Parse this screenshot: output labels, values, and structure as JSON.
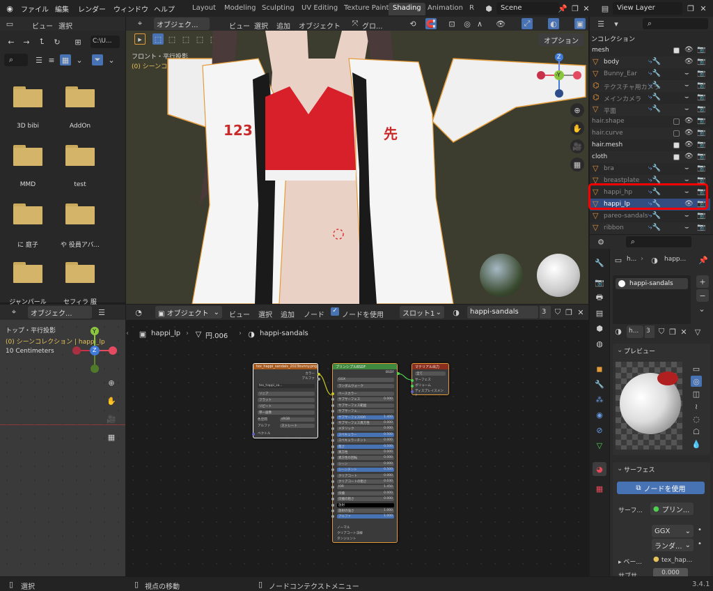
{
  "topbar": {
    "menus": [
      "ファイル",
      "編集",
      "レンダー",
      "ウィンドウ",
      "ヘルプ"
    ],
    "workspaces": [
      "Layout",
      "Modeling",
      "Sculpting",
      "UV Editing",
      "Texture Paint",
      "Shading",
      "Animation",
      "R"
    ],
    "active_workspace": "Shading",
    "scene": "Scene",
    "view_layer": "View Layer"
  },
  "filebrowser": {
    "menus": [
      "ビュー",
      "選択"
    ],
    "path": "C:\\U...",
    "folders": [
      "3D bibi",
      "AddOn",
      "MMD",
      "test",
      "に 庭子",
      "や 役員アバ...",
      "ジャンパール",
      "セフィラ 服"
    ]
  },
  "viewport": {
    "mode": "オブジェク...",
    "menus": [
      "ビュー",
      "選択",
      "追加",
      "オブジェクト"
    ],
    "transform": "グロ...",
    "options": "オプション",
    "view_name": "フロント・平行投影",
    "collection": "(0) シーンコレクション | happi_lp",
    "gizmo": {
      "z": "Z",
      "y": "-Y"
    }
  },
  "outliner": {
    "header": "ンコレクション",
    "rows": [
      {
        "label": "mesh",
        "type": "collection"
      },
      {
        "label": "body",
        "type": "object"
      },
      {
        "label": "Bunny_Ear",
        "type": "object"
      },
      {
        "label": "テクスチャ用カメラ",
        "type": "camera"
      },
      {
        "label": "メインカメラ",
        "type": "camera"
      },
      {
        "label": "平面",
        "type": "object"
      },
      {
        "label": "hair.shape",
        "type": "collection"
      },
      {
        "label": "hair.curve",
        "type": "collection"
      },
      {
        "label": "hair.mesh",
        "type": "collection"
      },
      {
        "label": "cloth",
        "type": "collection"
      },
      {
        "label": "bra",
        "type": "object"
      },
      {
        "label": "breastplate",
        "type": "object"
      },
      {
        "label": "happi_hp",
        "type": "object"
      },
      {
        "label": "happi_lp",
        "type": "object"
      },
      {
        "label": "pareo-sandals",
        "type": "object"
      },
      {
        "label": "ribbon",
        "type": "object"
      }
    ]
  },
  "properties": {
    "object_short": "h...",
    "material_short": "happ...",
    "material_slot": "happi-sandals",
    "mat_name_short": "h...",
    "users": "3",
    "preview_label": "プレビュー",
    "surface_label": "サーフェス",
    "use_nodes": "ノードを使用",
    "surface_field_label": "サーフ...",
    "surface_shader": "プリン...",
    "distribution": "GGX",
    "subsurface_method": "ランダ...",
    "base_label": "ベー...",
    "base_value": "tex_hap...",
    "subsurf_label": "サブサ...",
    "subsurf_value": "0.000",
    "version": "3.4.1"
  },
  "left_viewport": {
    "mode": "オブジェク...",
    "view_name": "トップ・平行投影",
    "collection": "(0) シーンコレクション | happi_lp",
    "scale": "10 Centimeters",
    "gizmo": {
      "y": "Y",
      "z": "Z"
    }
  },
  "node_editor": {
    "mode": "オブジェクト",
    "menus": [
      "ビュー",
      "選択",
      "追加",
      "ノード"
    ],
    "use_nodes": "ノードを使用",
    "slot": "スロット1",
    "material": "happi-sandals",
    "users": "3",
    "breadcrumb": [
      "happi_lp",
      "円.006",
      "happi-sandals"
    ],
    "image_node": {
      "title": "tex_happi_sandals_2023bunny.png",
      "outputs": [
        "カラー",
        "アルファ"
      ],
      "image": "tex_happi_sa...",
      "options": [
        "リニア",
        "フラット",
        "リピート",
        "単一画像"
      ],
      "color_space_label": "色空間",
      "color_space": "sRGB",
      "alpha_label": "アルファ",
      "alpha": "ストレート",
      "vector": "ベクトル"
    },
    "bsdf_node": {
      "title": "プリンシプルBSDF",
      "output": "BSDF",
      "dist": "GGX",
      "sss_method": "ランダムウォーク",
      "fields": [
        {
          "label": "ベースカラー",
          "value": "",
          "blue": false
        },
        {
          "label": "サブサーフェス",
          "value": "0.000",
          "blue": false
        },
        {
          "label": "サブサーフェス範囲",
          "value": "",
          "blue": false
        },
        {
          "label": "サブサーフェ...",
          "value": "",
          "blue": false
        },
        {
          "label": "サブサーフェスIOR",
          "value": "1.400",
          "blue": true
        },
        {
          "label": "サブサーフェス異方性",
          "value": "0.000",
          "blue": false
        },
        {
          "label": "メタリック",
          "value": "0.000",
          "blue": false
        },
        {
          "label": "スペキュラー",
          "value": "0.500",
          "blue": true
        },
        {
          "label": "スペキュラーチント",
          "value": "0.000",
          "blue": false
        },
        {
          "label": "粗さ",
          "value": "0.500",
          "blue": true
        },
        {
          "label": "異方性",
          "value": "0.000",
          "blue": false
        },
        {
          "label": "異方性の回転",
          "value": "0.000",
          "blue": false
        },
        {
          "label": "シーン",
          "value": "0.000",
          "blue": false
        },
        {
          "label": "シーンチント",
          "value": "0.500",
          "blue": true
        },
        {
          "label": "クリアコート",
          "value": "0.000",
          "blue": false
        },
        {
          "label": "クリアコートの粗さ",
          "value": "0.030",
          "blue": false
        },
        {
          "label": "IOR",
          "value": "1.450",
          "blue": false
        },
        {
          "label": "伝播",
          "value": "0.000",
          "blue": false
        },
        {
          "label": "伝播の粗さ",
          "value": "0.000",
          "blue": false
        },
        {
          "label": "放射",
          "value": "",
          "blue": false
        },
        {
          "label": "放射の強さ",
          "value": "1.000",
          "blue": false
        },
        {
          "label": "アルファ",
          "value": "1.000",
          "blue": true
        }
      ],
      "inputs_bottom": [
        "ノーマル",
        "クリアコート法線",
        "タンジェント"
      ]
    },
    "output_node": {
      "title": "マテリアル出力",
      "target": "全て",
      "inputs": [
        "サーフェス",
        "ボリューム",
        "ディスプレイスメント"
      ]
    }
  },
  "statusbar": {
    "select": "選択",
    "view_move": "視点の移動",
    "node_menu": "ノードコンテクストメニュー"
  },
  "colors": {
    "accent": "#4772b3",
    "highlight": "#ff0000",
    "viewport_bg": "#3c3c2f",
    "node_shader": "#3f8a3f",
    "node_texture": "#a8591c",
    "node_output": "#8c2e1e"
  }
}
